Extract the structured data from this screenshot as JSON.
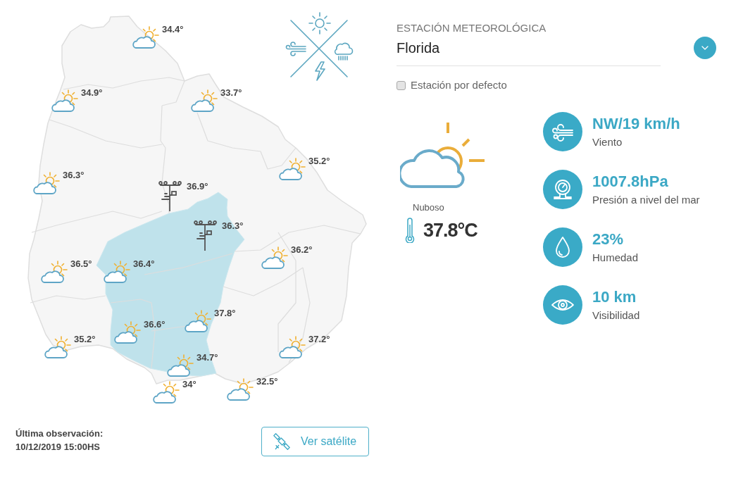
{
  "map": {
    "markers": [
      {
        "kind": "partly_cloudy",
        "temperature": "34.4°"
      },
      {
        "kind": "partly_cloudy",
        "temperature": "34.9°"
      },
      {
        "kind": "partly_cloudy",
        "temperature": "33.7°"
      },
      {
        "kind": "partly_cloudy",
        "temperature": "35.2°"
      },
      {
        "kind": "partly_cloudy",
        "temperature": "36.3°"
      },
      {
        "kind": "station",
        "temperature": "36.9°"
      },
      {
        "kind": "station",
        "temperature": "36.3°"
      },
      {
        "kind": "partly_cloudy",
        "temperature": "36.2°"
      },
      {
        "kind": "partly_cloudy",
        "temperature": "36.5°"
      },
      {
        "kind": "partly_cloudy",
        "temperature": "36.4°"
      },
      {
        "kind": "partly_cloudy",
        "temperature": "37.8°"
      },
      {
        "kind": "partly_cloudy",
        "temperature": "36.6°"
      },
      {
        "kind": "partly_cloudy",
        "temperature": "35.2°"
      },
      {
        "kind": "partly_cloudy",
        "temperature": "37.2°"
      },
      {
        "kind": "partly_cloudy",
        "temperature": "34.7°"
      },
      {
        "kind": "partly_cloudy",
        "temperature": "32.5°"
      },
      {
        "kind": "partly_cloudy",
        "temperature": "34°"
      }
    ]
  },
  "station": {
    "label": "ESTACIÓN METEOROLÓGICA",
    "value": "Florida"
  },
  "default_station": {
    "label": "Estación por defecto",
    "checked": false
  },
  "current": {
    "kind": "partly_cloudy",
    "condition": "Nuboso",
    "temperature": "37.8°C"
  },
  "stats": [
    {
      "kind": "wind",
      "value": "NW/19 km/h",
      "label": "Viento"
    },
    {
      "kind": "pressure",
      "value": "1007.8hPa",
      "label": "Presión a nivel del mar"
    },
    {
      "kind": "humidity",
      "value": "23%",
      "label": "Humedad"
    },
    {
      "kind": "visibility",
      "value": "10 km",
      "label": "Visibilidad"
    }
  ],
  "last_observation": {
    "label": "Última observación:",
    "value": "10/12/2019 15:00HS"
  },
  "satellite_button": {
    "label": "Ver satélite"
  }
}
